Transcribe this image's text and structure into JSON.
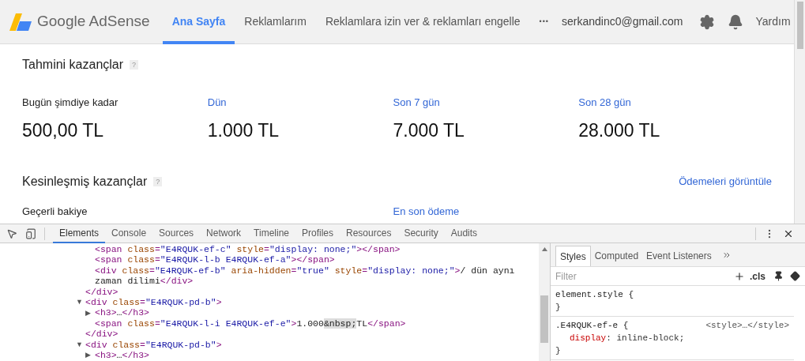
{
  "header": {
    "logo_text": "Google AdSense",
    "nav": [
      {
        "label": "Ana Sayfa",
        "selected": true
      },
      {
        "label": "Reklamlarım",
        "selected": false
      },
      {
        "label": "Reklamlara izin ver & reklamları engelle",
        "selected": false
      }
    ],
    "more": "•••",
    "account": "serkandinc0@gmail.com",
    "help": "Yardım"
  },
  "estimated": {
    "title": "Tahmini kazançlar",
    "help": "?",
    "metrics": [
      {
        "label": "Bugün şimdiye kadar",
        "value": "500,00 TL",
        "link": false
      },
      {
        "label": "Dün",
        "value": "1.000 TL",
        "link": true
      },
      {
        "label": "Son 7 gün",
        "value": "7.000 TL",
        "link": true
      },
      {
        "label": "Son 28 gün",
        "value": "28.000 TL",
        "link": true
      }
    ]
  },
  "finalized": {
    "title": "Kesinleşmiş kazançlar",
    "help": "?",
    "link": "Ödemeleri görüntüle",
    "columns": [
      {
        "label": "Geçerli bakiye",
        "link": false
      },
      {
        "label": "En son ödeme",
        "link": true
      }
    ]
  },
  "devtools": {
    "tabs": [
      {
        "label": "Elements",
        "selected": true
      },
      {
        "label": "Console",
        "selected": false
      },
      {
        "label": "Sources",
        "selected": false
      },
      {
        "label": "Network",
        "selected": false
      },
      {
        "label": "Timeline",
        "selected": false
      },
      {
        "label": "Profiles",
        "selected": false
      },
      {
        "label": "Resources",
        "selected": false
      },
      {
        "label": "Security",
        "selected": false
      },
      {
        "label": "Audits",
        "selected": false
      }
    ],
    "dom_tree": [
      {
        "children": [
          {
            "tokens": [
              {
                "kind": "tag",
                "t": "<span"
              },
              {
                "kind": "attr",
                "t": " class"
              },
              {
                "kind": "tag",
                "t": "="
              },
              {
                "kind": "value",
                "t": "\"E4RQUK-ef-c\""
              },
              {
                "kind": "attr",
                "t": " style"
              },
              {
                "kind": "tag",
                "t": "="
              },
              {
                "kind": "value",
                "t": "\"display: none;\""
              },
              {
                "kind": "tag",
                "t": "></span>"
              }
            ]
          },
          {
            "tokens": [
              {
                "kind": "tag",
                "t": "<span"
              },
              {
                "kind": "attr",
                "t": " class"
              },
              {
                "kind": "tag",
                "t": "="
              },
              {
                "kind": "value",
                "t": "\"E4RQUK-l-b E4RQUK-ef-a\""
              },
              {
                "kind": "tag",
                "t": "></span>"
              }
            ]
          },
          {
            "tokens": [
              {
                "kind": "tag",
                "t": "<div"
              },
              {
                "kind": "attr",
                "t": " class"
              },
              {
                "kind": "tag",
                "t": "="
              },
              {
                "kind": "value",
                "t": "\"E4RQUK-ef-b\""
              },
              {
                "kind": "attr",
                "t": " aria-hidden"
              },
              {
                "kind": "tag",
                "t": "="
              },
              {
                "kind": "value",
                "t": "\"true\""
              },
              {
                "kind": "attr",
                "t": " style"
              },
              {
                "kind": "tag",
                "t": "="
              },
              {
                "kind": "value",
                "t": "\"display: none;\""
              },
              {
                "kind": "tag",
                "t": ">"
              },
              {
                "kind": "text",
                "t": "/ dün aynı zaman dilimi"
              },
              {
                "kind": "tag",
                "t": "</div>"
              }
            ]
          }
        ],
        "close": [
          {
            "kind": "tag",
            "t": "</div>"
          }
        ]
      },
      {
        "toggle": "▼",
        "tokens": [
          {
            "kind": "tag",
            "t": "<div"
          },
          {
            "kind": "attr",
            "t": " class"
          },
          {
            "kind": "tag",
            "t": "="
          },
          {
            "kind": "value",
            "t": "\"E4RQUK-pd-b\""
          },
          {
            "kind": "tag",
            "t": ">"
          }
        ],
        "children": [
          {
            "toggle": "▶",
            "tokens": [
              {
                "kind": "tag",
                "t": "<h3>"
              },
              {
                "kind": "text",
                "t": "…"
              },
              {
                "kind": "tag",
                "t": "</h3>"
              }
            ]
          },
          {
            "tokens": [
              {
                "kind": "tag",
                "t": "<span"
              },
              {
                "kind": "attr",
                "t": " class"
              },
              {
                "kind": "tag",
                "t": "="
              },
              {
                "kind": "value",
                "t": "\"E4RQUK-l-i E4RQUK-ef-e\""
              },
              {
                "kind": "tag",
                "t": ">"
              },
              {
                "kind": "text",
                "t": "1.000"
              },
              {
                "kind": "entity",
                "t": "&nbsp;"
              },
              {
                "kind": "text",
                "t": "TL"
              },
              {
                "kind": "tag",
                "t": "</span>"
              }
            ]
          }
        ],
        "close": [
          {
            "kind": "tag",
            "t": "</div>"
          }
        ]
      },
      {
        "toggle": "▼",
        "tokens": [
          {
            "kind": "tag",
            "t": "<div"
          },
          {
            "kind": "attr",
            "t": " class"
          },
          {
            "kind": "tag",
            "t": "="
          },
          {
            "kind": "value",
            "t": "\"E4RQUK-pd-b\""
          },
          {
            "kind": "tag",
            "t": ">"
          }
        ],
        "children": [
          {
            "toggle": "▶",
            "tokens": [
              {
                "kind": "tag",
                "t": "<h3>"
              },
              {
                "kind": "text",
                "t": "…"
              },
              {
                "kind": "tag",
                "t": "</h3>"
              }
            ]
          }
        ]
      }
    ],
    "side_tabs": [
      {
        "label": "Styles",
        "selected": true
      },
      {
        "label": "Computed",
        "selected": false
      },
      {
        "label": "Event Listeners",
        "selected": false
      }
    ],
    "filter_placeholder": "Filter",
    "cls": ".cls",
    "rules": [
      {
        "selector": "element.style {",
        "close": "}"
      },
      {
        "selector": ".E4RQUK-ef-e {",
        "source": "<style>…</style>",
        "props": [
          {
            "name": "display",
            "sep": ":",
            "value": "inline-block;"
          }
        ],
        "close": "}"
      }
    ]
  }
}
